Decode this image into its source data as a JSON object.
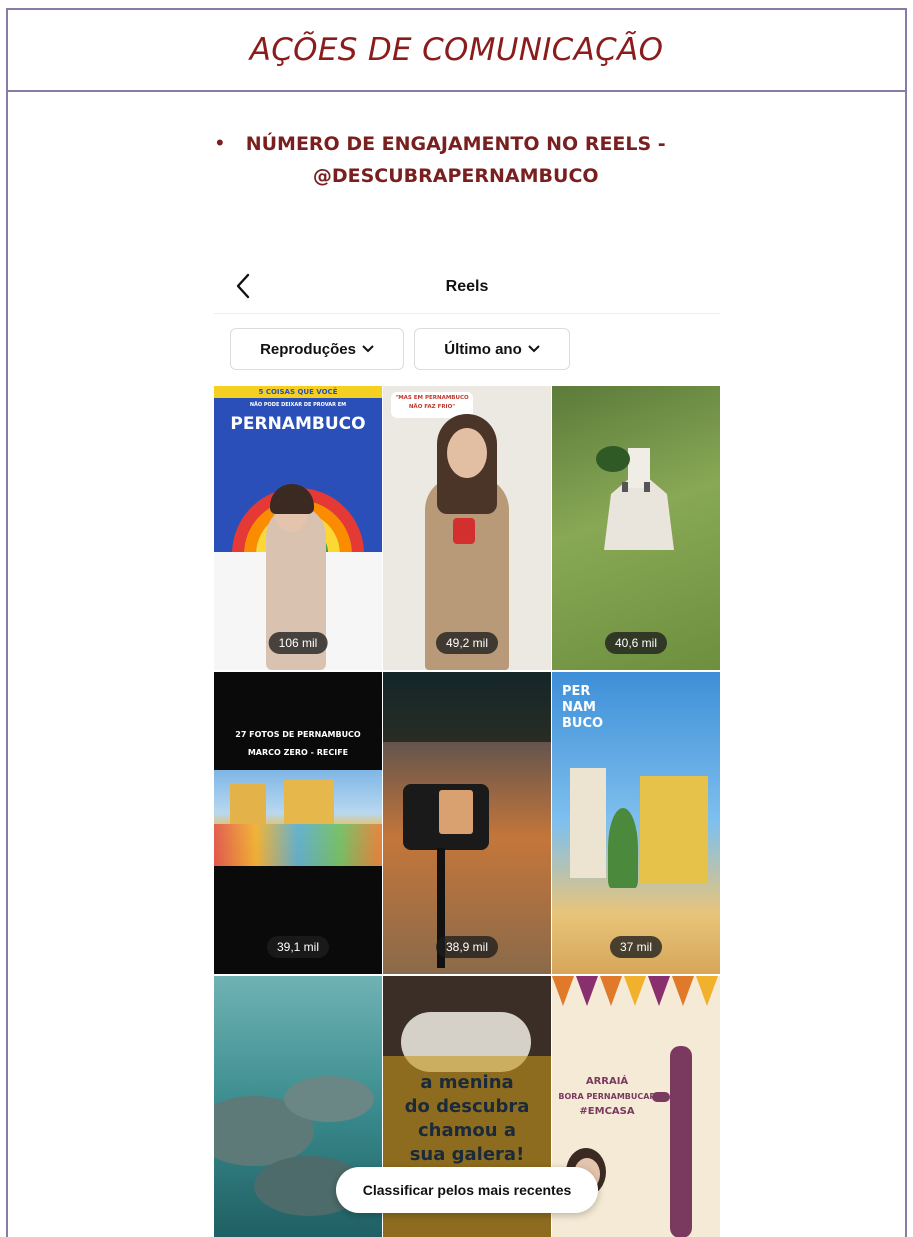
{
  "page": {
    "title": "AÇÕES DE COMUNICAÇÃO",
    "bullet": "•",
    "heading_line1": "NÚMERO DE ENGAJAMENTO NO REELS -",
    "heading_line2": "@DESCUBRAPERNAMBUCO"
  },
  "app": {
    "title": "Reels",
    "filters": [
      {
        "label": "Reproduções"
      },
      {
        "label": "Último ano"
      }
    ],
    "sort_button": "Classificar pelos mais recentes"
  },
  "reels": [
    {
      "count": "106 mil",
      "lines": [
        "5 COISAS QUE VOCÊ",
        "NÃO PODE DEIXAR DE PROVAR EM",
        "PERNAMBUCO"
      ]
    },
    {
      "count": "49,2 mil",
      "lines": [
        "\"MAS EM PERNAMBUCO",
        "NÃO FAZ FRIO\""
      ]
    },
    {
      "count": "40,6 mil",
      "lines": []
    },
    {
      "count": "39,1 mil",
      "lines": [
        "27 FOTOS DE PERNAMBUCO",
        "MARCO ZERO - RECIFE"
      ]
    },
    {
      "count": "38,9 mil",
      "lines": []
    },
    {
      "count": "37 mil",
      "lines": [
        "PER",
        "NAM",
        "BUCO"
      ]
    },
    {
      "count": "",
      "lines": []
    },
    {
      "count": "",
      "lines": [
        "a menina",
        "do descubra",
        "chamou a",
        "sua galera!"
      ]
    },
    {
      "count": "",
      "lines": [
        "ARRAIÁ",
        "BORA PERNAMBUCAR",
        "#EMCASA"
      ]
    }
  ],
  "colors": {
    "title": "#8b1c1c",
    "heading": "#7a1f1f",
    "frame": "#8a7aa8"
  }
}
